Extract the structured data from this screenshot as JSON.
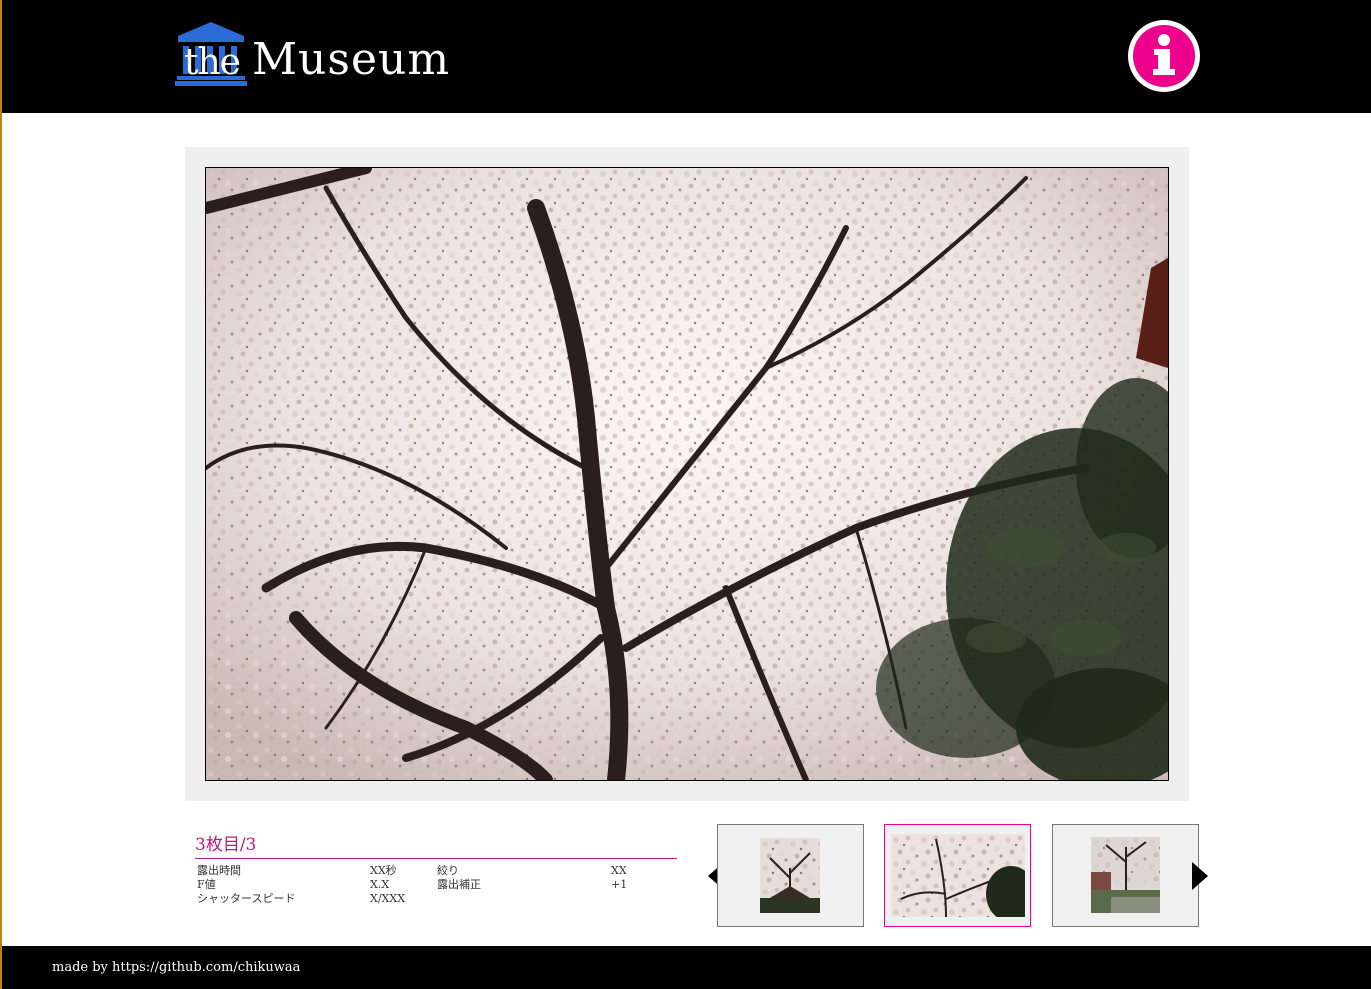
{
  "header": {
    "logo_the": "the",
    "logo_museum": "Museum",
    "logo_icon": "museum-building-icon",
    "info_icon": "info-icon"
  },
  "colors": {
    "accent": "#ec008c",
    "logo_blue": "#2b6bd6",
    "header_bg": "#000000",
    "frame_bg": "#efefef"
  },
  "caption": {
    "counter": "3枚目/3",
    "exif": {
      "exposure_time_label": "露出時間",
      "exposure_time_value": "XX秒",
      "fnumber_label": "F値",
      "fnumber_value": "X.X",
      "shutter_label": "シャッタースピード",
      "shutter_value": "X/XXX",
      "aperture_label": "絞り",
      "aperture_value": "XX",
      "compensation_label": "露出補正",
      "compensation_value": "+1"
    }
  },
  "gallery": {
    "prev_icon": "chevron-left-icon",
    "next_icon": "chevron-right-icon",
    "active_index": 2
  },
  "footer": {
    "credit": "made by https://github.com/chikuwaa"
  }
}
